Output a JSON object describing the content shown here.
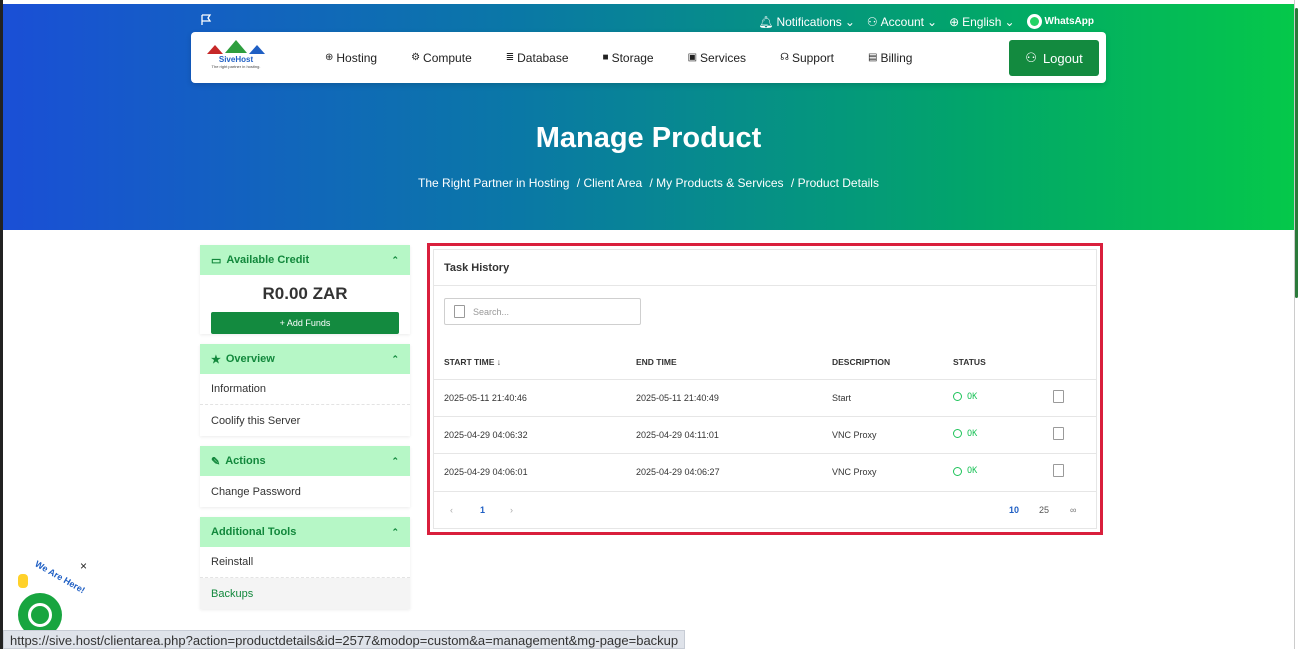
{
  "topbar": {
    "notifications": "Notifications",
    "account": "Account",
    "language": "English",
    "whatsapp": "WhatsApp"
  },
  "logo": {
    "name": "SiveHost",
    "tagline": "The right partner in hosting."
  },
  "nav": {
    "items": [
      {
        "label": "Hosting",
        "icon": "globe-icon"
      },
      {
        "label": "Compute",
        "icon": "chip-icon"
      },
      {
        "label": "Database",
        "icon": "database-icon"
      },
      {
        "label": "Storage",
        "icon": "box-icon"
      },
      {
        "label": "Services",
        "icon": "gift-icon"
      },
      {
        "label": "Support",
        "icon": "headset-icon"
      },
      {
        "label": "Billing",
        "icon": "receipt-icon"
      }
    ],
    "logout": "Logout"
  },
  "hero": {
    "title": "Manage Product",
    "breadcrumb": [
      "The Right Partner in Hosting",
      "/ Client Area",
      "/ My Products & Services",
      "/ Product Details"
    ]
  },
  "sidebar": {
    "credit": {
      "title": "Available Credit",
      "amount": "R0.00 ZAR",
      "add_funds": "+ Add Funds"
    },
    "overview": {
      "title": "Overview",
      "items": [
        "Information",
        "Coolify this Server"
      ]
    },
    "actions": {
      "title": "Actions",
      "items": [
        "Change Password"
      ]
    },
    "tools": {
      "title": "Additional Tools",
      "items": [
        "Reinstall",
        "Backups"
      ]
    }
  },
  "task_history": {
    "title": "Task History",
    "search_placeholder": "Search...",
    "columns": [
      "START TIME",
      "END TIME",
      "DESCRIPTION",
      "STATUS"
    ],
    "rows": [
      {
        "start": "2025-05-11 21:40:46",
        "end": "2025-05-11 21:40:49",
        "desc": "Start",
        "status": "OK"
      },
      {
        "start": "2025-04-29 04:06:32",
        "end": "2025-04-29 04:11:01",
        "desc": "VNC Proxy",
        "status": "OK"
      },
      {
        "start": "2025-04-29 04:06:01",
        "end": "2025-04-29 04:06:27",
        "desc": "VNC Proxy",
        "status": "OK"
      }
    ],
    "pagination": {
      "prev": "‹",
      "page": "1",
      "next": "›",
      "sizes": [
        "10",
        "25",
        "∞"
      ]
    }
  },
  "chat": {
    "label": "We Are Here!",
    "close": "×"
  },
  "status_url": "https://sive.host/clientarea.php?action=productdetails&id=2577&modop=custom&a=management&mg-page=backup",
  "colors": {
    "accent_green": "#138a3f",
    "highlight_red": "#d91f3c",
    "header_light_green": "#b6f7c6"
  }
}
